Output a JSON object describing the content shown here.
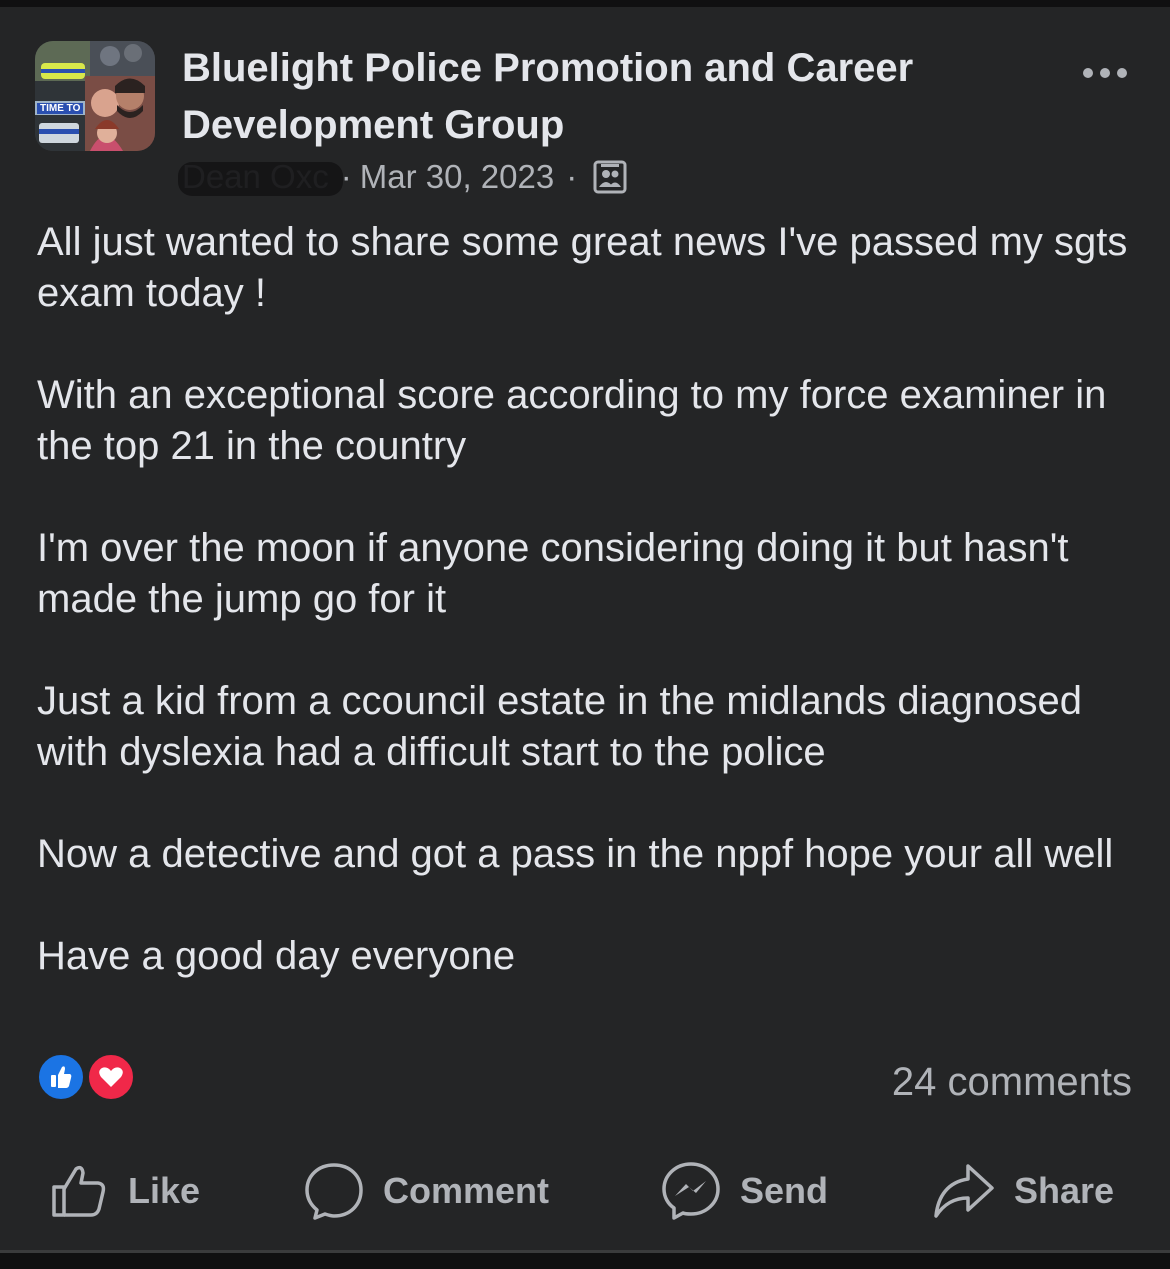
{
  "post": {
    "group_name": "Bluelight Police Promotion and Career Development Group",
    "author": "Dean Oxc",
    "date": "Mar 30, 2023",
    "separator": "·",
    "avatar_overlay_text": "TIME TO",
    "paragraphs": [
      "All just wanted to share some great news I've passed my sgts exam today !",
      "With an exceptional score according to my force examiner in the top 21 in the country",
      "I'm over the moon if anyone considering doing it but hasn't made the jump go for it",
      "Just a kid from a ccouncil estate in the midlands diagnosed with dyslexia had a difficult start to the police",
      "Now a detective and got a pass in the nppf hope your all well",
      "Have a good day everyone"
    ],
    "comments_count": "24 comments",
    "reaction_icons": [
      "like-reaction-icon",
      "love-reaction-icon"
    ]
  },
  "actions": {
    "like": "Like",
    "comment": "Comment",
    "send": "Send",
    "share": "Share"
  },
  "colors": {
    "background": "#242526",
    "text_primary": "#e4e6eb",
    "text_secondary": "#b0b3b8",
    "like_blue": "#1b74e4",
    "love_red": "#f02849"
  }
}
